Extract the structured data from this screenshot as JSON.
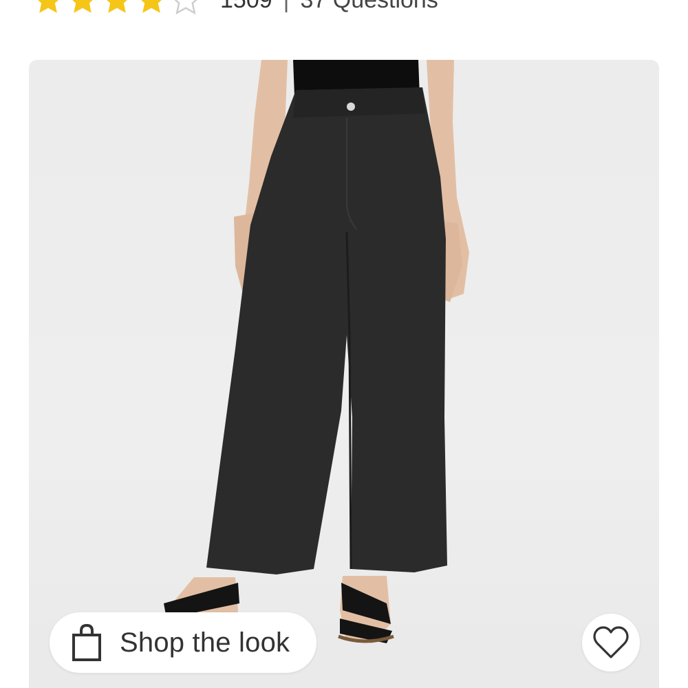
{
  "rating": {
    "value": 4,
    "max": 5,
    "count": "1509",
    "separator": "|",
    "questions": "37 Questions",
    "star_color": "#f5c518",
    "empty_star_color": "#cccccc"
  },
  "product": {
    "image_icon": "product-photo-black-wide-leg-jeans"
  },
  "actions": {
    "shop_look_label": "Shop the look",
    "shop_look_icon": "shopping-bag-icon",
    "favorite_icon": "heart-icon"
  }
}
